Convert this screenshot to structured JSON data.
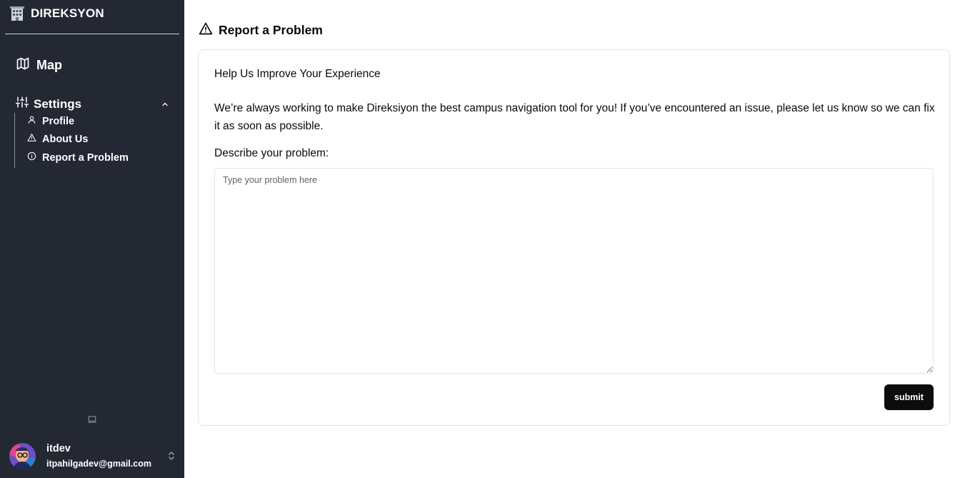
{
  "sidebar": {
    "brand": {
      "name": "DIREKSYON",
      "icon": "building-icon"
    },
    "nav": {
      "map": {
        "label": "Map",
        "icon": "map-icon"
      },
      "settings": {
        "label": "Settings",
        "icon": "sliders-icon",
        "expanded": true,
        "items": [
          {
            "label": "Profile",
            "icon": "user-icon"
          },
          {
            "label": "About Us",
            "icon": "warning-icon"
          },
          {
            "label": "Report a Problem",
            "icon": "info-icon"
          }
        ]
      }
    },
    "footer_icon": "laptop-icon",
    "user": {
      "name": "itdev",
      "email": "itpahilgadev@gmail.com"
    }
  },
  "main": {
    "title": "Report a Problem",
    "title_icon": "warning-icon",
    "card": {
      "heading": "Help Us Improve Your Experience",
      "intro": "We’re always working to make Direksiyon the best campus navigation tool for you! If you’ve encountered an issue, please let us know so we can fix it as soon as possible.",
      "prompt": "Describe your problem:",
      "problem": {
        "value": "",
        "placeholder": "Type your problem here"
      },
      "submit_label": "submit"
    }
  },
  "colors": {
    "sidebar_bg": "#232833",
    "sidebar_text": "#ffffff",
    "button_bg": "#0c0c0c",
    "border": "#e4e4e7"
  }
}
